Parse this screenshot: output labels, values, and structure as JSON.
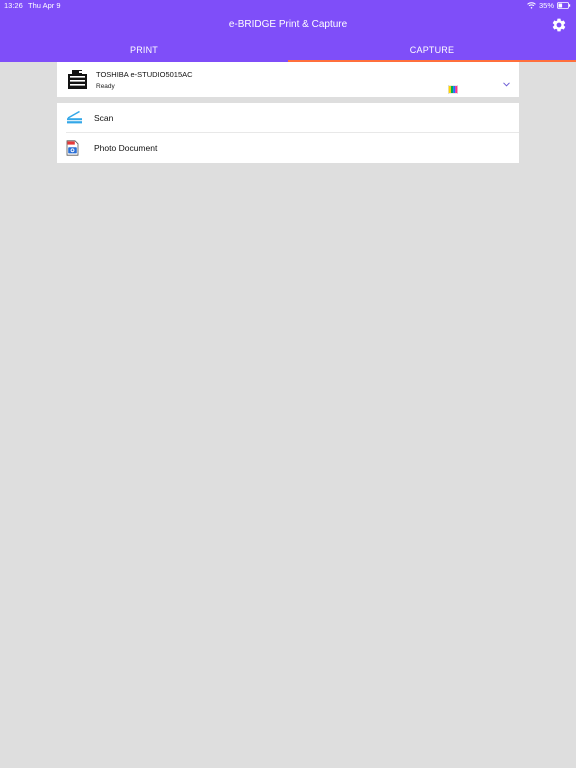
{
  "status_bar": {
    "time": "13:26",
    "date": "Thu Apr 9",
    "battery": "35%"
  },
  "header": {
    "title": "e-BRIDGE Print & Capture",
    "settings_icon": "gear-icon",
    "tabs": [
      {
        "label": "PRINT",
        "selected": false
      },
      {
        "label": "CAPTURE",
        "selected": true
      }
    ],
    "colors": {
      "background": "#7f4ef9",
      "active_tab_indicator": "#ff6f3c"
    }
  },
  "printer": {
    "name": "TOSHIBA e-STUDIO5015AC",
    "status": "Ready",
    "icon": "printer-icon",
    "color_icon": "color-icon",
    "dropdown_icon": "chevron-down-icon"
  },
  "capture_menu": {
    "items": [
      {
        "label": "Scan",
        "icon": "scan-icon"
      },
      {
        "label": "Photo Document",
        "icon": "photo-document-icon"
      }
    ]
  }
}
